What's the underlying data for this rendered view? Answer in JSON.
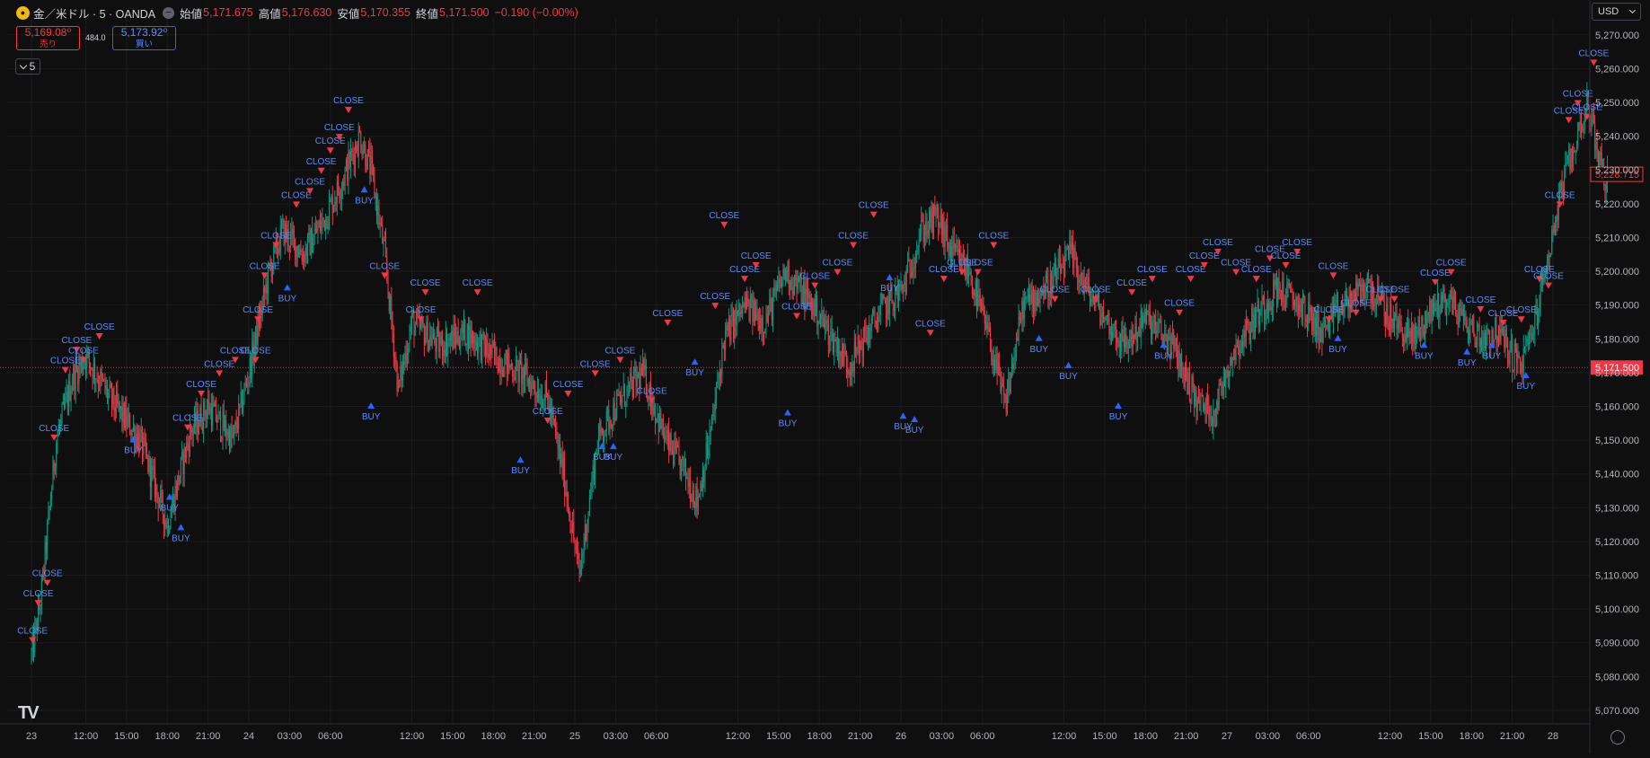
{
  "header": {
    "symbol": "金／米ドル · 5 · OANDA",
    "open_label": "始値",
    "open": "5,171.675",
    "high_label": "高値",
    "high": "5,176.630",
    "low_label": "安値",
    "low": "5,170.355",
    "close_label": "終値",
    "close": "5,171.500",
    "change": "−0.190 (−0.00%)"
  },
  "trade": {
    "sell_price": "5,169.08⁰",
    "sell_label": "売り",
    "buy_price": "5,173.92⁰",
    "buy_label": "買い",
    "spread": "484.0"
  },
  "interval_label": "5",
  "currency": "USD",
  "colors": {
    "bg": "#0f0f0f",
    "up": "#089981",
    "down": "#f23645",
    "signal_blue": "#2962ff",
    "signal_red": "#f23645",
    "grid": "#1c1c1c"
  },
  "chart_data": {
    "type": "candlestick",
    "ylim": [
      5066,
      5275
    ],
    "y_ticks": [
      5070,
      5080,
      5090,
      5100,
      5110,
      5120,
      5130,
      5140,
      5150,
      5160,
      5170,
      5180,
      5190,
      5200,
      5210,
      5220,
      5230,
      5240,
      5250,
      5260,
      5270
    ],
    "x_ticks": [
      "23",
      "12:00",
      "15:00",
      "18:00",
      "21:00",
      "24",
      "03:00",
      "06:00",
      "12:00",
      "15:00",
      "18:00",
      "21:00",
      "25",
      "03:00",
      "06:00",
      "12:00",
      "15:00",
      "18:00",
      "21:00",
      "26",
      "03:00",
      "06:00",
      "12:00",
      "15:00",
      "18:00",
      "21:00",
      "27",
      "03:00",
      "06:00",
      "12:00",
      "15:00",
      "18:00",
      "21:00",
      "28"
    ],
    "x_tick_steps": [
      0,
      48,
      84,
      120,
      156,
      192,
      228,
      264,
      336,
      372,
      408,
      444,
      480,
      516,
      552,
      624,
      660,
      696,
      732,
      768,
      804,
      840,
      912,
      948,
      984,
      1020,
      1056,
      1092,
      1128,
      1200,
      1236,
      1272,
      1308,
      1344
    ],
    "total_steps": 1392,
    "close_path": [
      [
        0,
        5086
      ],
      [
        8,
        5102
      ],
      [
        22,
        5150
      ],
      [
        36,
        5168
      ],
      [
        48,
        5175
      ],
      [
        70,
        5162
      ],
      [
        96,
        5150
      ],
      [
        120,
        5125
      ],
      [
        140,
        5152
      ],
      [
        156,
        5160
      ],
      [
        178,
        5150
      ],
      [
        192,
        5170
      ],
      [
        210,
        5200
      ],
      [
        222,
        5212
      ],
      [
        240,
        5205
      ],
      [
        258,
        5215
      ],
      [
        276,
        5228
      ],
      [
        290,
        5240
      ],
      [
        300,
        5230
      ],
      [
        312,
        5205
      ],
      [
        324,
        5165
      ],
      [
        336,
        5185
      ],
      [
        360,
        5178
      ],
      [
        384,
        5182
      ],
      [
        408,
        5175
      ],
      [
        432,
        5170
      ],
      [
        456,
        5162
      ],
      [
        470,
        5140
      ],
      [
        484,
        5110
      ],
      [
        500,
        5150
      ],
      [
        516,
        5160
      ],
      [
        540,
        5170
      ],
      [
        560,
        5150
      ],
      [
        578,
        5140
      ],
      [
        588,
        5132
      ],
      [
        600,
        5152
      ],
      [
        612,
        5180
      ],
      [
        630,
        5190
      ],
      [
        648,
        5185
      ],
      [
        666,
        5200
      ],
      [
        690,
        5190
      ],
      [
        708,
        5180
      ],
      [
        722,
        5172
      ],
      [
        732,
        5178
      ],
      [
        750,
        5188
      ],
      [
        770,
        5195
      ],
      [
        786,
        5212
      ],
      [
        800,
        5216
      ],
      [
        812,
        5206
      ],
      [
        828,
        5200
      ],
      [
        846,
        5180
      ],
      [
        860,
        5160
      ],
      [
        876,
        5190
      ],
      [
        900,
        5196
      ],
      [
        918,
        5205
      ],
      [
        930,
        5196
      ],
      [
        950,
        5185
      ],
      [
        966,
        5178
      ],
      [
        984,
        5186
      ],
      [
        1008,
        5178
      ],
      [
        1028,
        5162
      ],
      [
        1044,
        5158
      ],
      [
        1060,
        5175
      ],
      [
        1080,
        5186
      ],
      [
        1100,
        5195
      ],
      [
        1120,
        5190
      ],
      [
        1140,
        5182
      ],
      [
        1160,
        5190
      ],
      [
        1180,
        5196
      ],
      [
        1200,
        5186
      ],
      [
        1220,
        5180
      ],
      [
        1240,
        5190
      ],
      [
        1252,
        5192
      ],
      [
        1266,
        5185
      ],
      [
        1280,
        5180
      ],
      [
        1296,
        5182
      ],
      [
        1306,
        5176
      ],
      [
        1316,
        5172
      ],
      [
        1328,
        5185
      ],
      [
        1340,
        5205
      ],
      [
        1352,
        5225
      ],
      [
        1364,
        5238
      ],
      [
        1374,
        5250
      ],
      [
        1382,
        5238
      ],
      [
        1390,
        5226
      ]
    ],
    "last_price": 5171.5,
    "last_price_label": "5,171.500",
    "marked_price": 5228.715,
    "marked_price_label": "5,228.715",
    "signals": [
      {
        "t": 1,
        "p": 5089,
        "type": "CLOSE"
      },
      {
        "t": 6,
        "p": 5100,
        "type": "CLOSE"
      },
      {
        "t": 14,
        "p": 5106,
        "type": "CLOSE"
      },
      {
        "t": 20,
        "p": 5149,
        "type": "CLOSE"
      },
      {
        "t": 30,
        "p": 5169,
        "type": "CLOSE"
      },
      {
        "t": 40,
        "p": 5175,
        "type": "CLOSE"
      },
      {
        "t": 46,
        "p": 5172,
        "type": "CLOSE"
      },
      {
        "t": 60,
        "p": 5179,
        "type": "CLOSE"
      },
      {
        "t": 90,
        "p": 5152,
        "type": "BUY"
      },
      {
        "t": 122,
        "p": 5135,
        "type": "BUY"
      },
      {
        "t": 132,
        "p": 5126,
        "type": "BUY"
      },
      {
        "t": 138,
        "p": 5152,
        "type": "CLOSE"
      },
      {
        "t": 150,
        "p": 5162,
        "type": "CLOSE"
      },
      {
        "t": 166,
        "p": 5168,
        "type": "CLOSE"
      },
      {
        "t": 180,
        "p": 5172,
        "type": "CLOSE"
      },
      {
        "t": 198,
        "p": 5172,
        "type": "CLOSE"
      },
      {
        "t": 200,
        "p": 5184,
        "type": "CLOSE"
      },
      {
        "t": 206,
        "p": 5197,
        "type": "CLOSE"
      },
      {
        "t": 216,
        "p": 5206,
        "type": "CLOSE"
      },
      {
        "t": 226,
        "p": 5197,
        "type": "BUY"
      },
      {
        "t": 234,
        "p": 5218,
        "type": "CLOSE"
      },
      {
        "t": 246,
        "p": 5222,
        "type": "CLOSE"
      },
      {
        "t": 256,
        "p": 5228,
        "type": "CLOSE"
      },
      {
        "t": 264,
        "p": 5234,
        "type": "CLOSE"
      },
      {
        "t": 272,
        "p": 5238,
        "type": "CLOSE"
      },
      {
        "t": 280,
        "p": 5246,
        "type": "CLOSE"
      },
      {
        "t": 294,
        "p": 5226,
        "type": "BUY"
      },
      {
        "t": 312,
        "p": 5197,
        "type": "CLOSE"
      },
      {
        "t": 300,
        "p": 5162,
        "type": "BUY"
      },
      {
        "t": 344,
        "p": 5184,
        "type": "CLOSE"
      },
      {
        "t": 348,
        "p": 5192,
        "type": "CLOSE"
      },
      {
        "t": 394,
        "p": 5192,
        "type": "CLOSE"
      },
      {
        "t": 432,
        "p": 5146,
        "type": "BUY"
      },
      {
        "t": 456,
        "p": 5154,
        "type": "CLOSE"
      },
      {
        "t": 474,
        "p": 5162,
        "type": "CLOSE"
      },
      {
        "t": 498,
        "p": 5168,
        "type": "CLOSE"
      },
      {
        "t": 504,
        "p": 5150,
        "type": "BUY"
      },
      {
        "t": 514,
        "p": 5150,
        "type": "BUY"
      },
      {
        "t": 520,
        "p": 5172,
        "type": "CLOSE"
      },
      {
        "t": 548,
        "p": 5160,
        "type": "CLOSE"
      },
      {
        "t": 562,
        "p": 5183,
        "type": "CLOSE"
      },
      {
        "t": 586,
        "p": 5175,
        "type": "BUY"
      },
      {
        "t": 604,
        "p": 5188,
        "type": "CLOSE"
      },
      {
        "t": 612,
        "p": 5212,
        "type": "CLOSE"
      },
      {
        "t": 630,
        "p": 5196,
        "type": "CLOSE"
      },
      {
        "t": 640,
        "p": 5200,
        "type": "CLOSE"
      },
      {
        "t": 668,
        "p": 5160,
        "type": "BUY"
      },
      {
        "t": 676,
        "p": 5185,
        "type": "CLOSE"
      },
      {
        "t": 692,
        "p": 5194,
        "type": "CLOSE"
      },
      {
        "t": 712,
        "p": 5198,
        "type": "CLOSE"
      },
      {
        "t": 726,
        "p": 5206,
        "type": "CLOSE"
      },
      {
        "t": 744,
        "p": 5215,
        "type": "CLOSE"
      },
      {
        "t": 758,
        "p": 5200,
        "type": "BUY"
      },
      {
        "t": 770,
        "p": 5159,
        "type": "BUY"
      },
      {
        "t": 780,
        "p": 5158,
        "type": "BUY"
      },
      {
        "t": 794,
        "p": 5180,
        "type": "CLOSE"
      },
      {
        "t": 806,
        "p": 5196,
        "type": "CLOSE"
      },
      {
        "t": 822,
        "p": 5198,
        "type": "CLOSE"
      },
      {
        "t": 836,
        "p": 5198,
        "type": "CLOSE"
      },
      {
        "t": 850,
        "p": 5206,
        "type": "CLOSE"
      },
      {
        "t": 890,
        "p": 5182,
        "type": "BUY"
      },
      {
        "t": 904,
        "p": 5190,
        "type": "CLOSE"
      },
      {
        "t": 916,
        "p": 5174,
        "type": "BUY"
      },
      {
        "t": 940,
        "p": 5190,
        "type": "CLOSE"
      },
      {
        "t": 960,
        "p": 5162,
        "type": "BUY"
      },
      {
        "t": 972,
        "p": 5192,
        "type": "CLOSE"
      },
      {
        "t": 990,
        "p": 5196,
        "type": "CLOSE"
      },
      {
        "t": 1000,
        "p": 5180,
        "type": "BUY"
      },
      {
        "t": 1014,
        "p": 5186,
        "type": "CLOSE"
      },
      {
        "t": 1024,
        "p": 5196,
        "type": "CLOSE"
      },
      {
        "t": 1036,
        "p": 5200,
        "type": "CLOSE"
      },
      {
        "t": 1048,
        "p": 5204,
        "type": "CLOSE"
      },
      {
        "t": 1064,
        "p": 5198,
        "type": "CLOSE"
      },
      {
        "t": 1082,
        "p": 5196,
        "type": "CLOSE"
      },
      {
        "t": 1094,
        "p": 5202,
        "type": "CLOSE"
      },
      {
        "t": 1108,
        "p": 5200,
        "type": "CLOSE"
      },
      {
        "t": 1118,
        "p": 5204,
        "type": "CLOSE"
      },
      {
        "t": 1146,
        "p": 5184,
        "type": "CLOSE"
      },
      {
        "t": 1150,
        "p": 5197,
        "type": "CLOSE"
      },
      {
        "t": 1154,
        "p": 5182,
        "type": "BUY"
      },
      {
        "t": 1170,
        "p": 5186,
        "type": "CLOSE"
      },
      {
        "t": 1192,
        "p": 5190,
        "type": "CLOSE"
      },
      {
        "t": 1204,
        "p": 5190,
        "type": "CLOSE"
      },
      {
        "t": 1230,
        "p": 5180,
        "type": "BUY"
      },
      {
        "t": 1240,
        "p": 5195,
        "type": "CLOSE"
      },
      {
        "t": 1254,
        "p": 5198,
        "type": "CLOSE"
      },
      {
        "t": 1268,
        "p": 5178,
        "type": "BUY"
      },
      {
        "t": 1280,
        "p": 5187,
        "type": "CLOSE"
      },
      {
        "t": 1290,
        "p": 5180,
        "type": "BUY"
      },
      {
        "t": 1300,
        "p": 5183,
        "type": "CLOSE"
      },
      {
        "t": 1316,
        "p": 5184,
        "type": "CLOSE"
      },
      {
        "t": 1320,
        "p": 5171,
        "type": "BUY"
      },
      {
        "t": 1332,
        "p": 5196,
        "type": "CLOSE"
      },
      {
        "t": 1340,
        "p": 5194,
        "type": "CLOSE"
      },
      {
        "t": 1350,
        "p": 5218,
        "type": "CLOSE"
      },
      {
        "t": 1358,
        "p": 5243,
        "type": "CLOSE"
      },
      {
        "t": 1366,
        "p": 5248,
        "type": "CLOSE"
      },
      {
        "t": 1374,
        "p": 5244,
        "type": "CLOSE"
      },
      {
        "t": 1380,
        "p": 5260,
        "type": "CLOSE"
      }
    ]
  }
}
